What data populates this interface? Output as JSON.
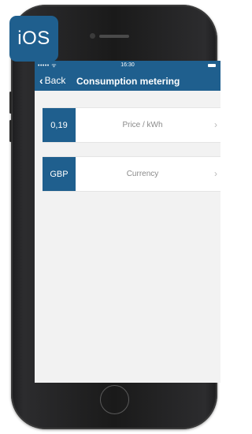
{
  "badge": {
    "label": "iOS"
  },
  "status_bar": {
    "signal": "•••••  ᯤ",
    "time": "16:30"
  },
  "nav": {
    "back_label": "Back",
    "title": "Consumption metering"
  },
  "settings": [
    {
      "value": "0,19",
      "label": "Price / kWh"
    },
    {
      "value": "GBP",
      "label": "Currency"
    }
  ],
  "icons": {
    "back": "chevron-left-icon",
    "row_chevron": "chevron-right-icon",
    "battery": "battery-icon"
  },
  "colors": {
    "accent": "#1f5f8e",
    "background": "#f2f2f2"
  }
}
